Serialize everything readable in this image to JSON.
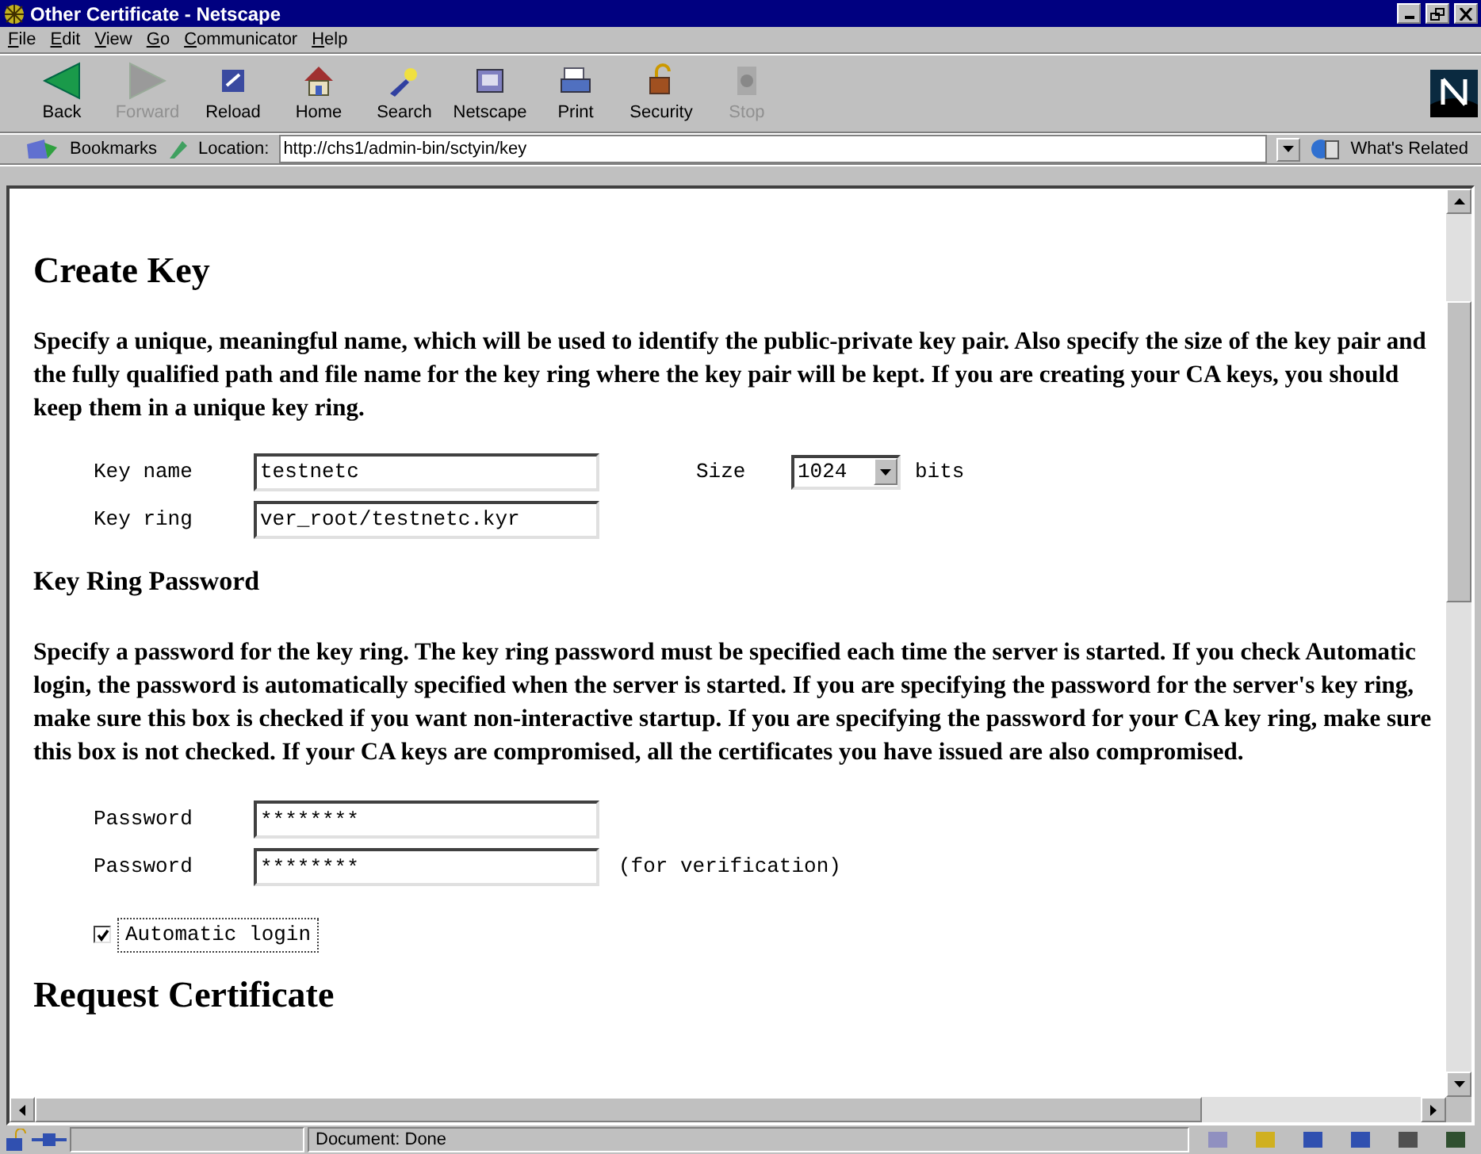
{
  "window": {
    "title": "Other Certificate - Netscape"
  },
  "menu": [
    "File",
    "Edit",
    "View",
    "Go",
    "Communicator",
    "Help"
  ],
  "toolbar": [
    {
      "label": "Back",
      "disabled": false
    },
    {
      "label": "Forward",
      "disabled": true
    },
    {
      "label": "Reload",
      "disabled": false
    },
    {
      "label": "Home",
      "disabled": false
    },
    {
      "label": "Search",
      "disabled": false
    },
    {
      "label": "Netscape",
      "disabled": false
    },
    {
      "label": "Print",
      "disabled": false
    },
    {
      "label": "Security",
      "disabled": false
    },
    {
      "label": "Stop",
      "disabled": true
    }
  ],
  "location_bar": {
    "bookmarks": "Bookmarks",
    "location_label": "Location:",
    "url": "http://chs1/admin-bin/sctyin/key",
    "whats_related": "What's Related"
  },
  "page": {
    "heading": "Create Key",
    "intro": "Specify a unique, meaningful name, which will be used to identify the public-private key pair. Also specify the size of the key pair and the fully qualified path and file name for the key ring where the key pair will be kept. If you are creating your CA keys, you should keep them in a unique key ring.",
    "key_name": {
      "label": "Key name",
      "value": "testnetc"
    },
    "size": {
      "label": "Size",
      "value": "1024",
      "unit": "bits"
    },
    "key_ring": {
      "label": "Key ring",
      "value": "ver_root/testnetc.kyr"
    },
    "password_heading": "Key Ring Password",
    "password_text": "Specify a password for the key ring. The key ring password must be specified each time the server is started. If you check Automatic login, the password is automatically specified when the server is started. If you are specifying the password for the server's key ring, make sure this box is checked if you want non-interactive startup. If you are specifying the password for your CA key ring, make sure this box is not checked. If your CA keys are compromised, all the certificates you have issued are also compromised.",
    "password": {
      "label": "Password",
      "value": "********"
    },
    "password_verify": {
      "label": "Password",
      "value": "********",
      "note": "(for verification)"
    },
    "automatic_login": {
      "label": "Automatic login",
      "checked": true
    },
    "next_heading": "Request Certificate"
  },
  "status_bar": {
    "text": "Document: Done"
  }
}
